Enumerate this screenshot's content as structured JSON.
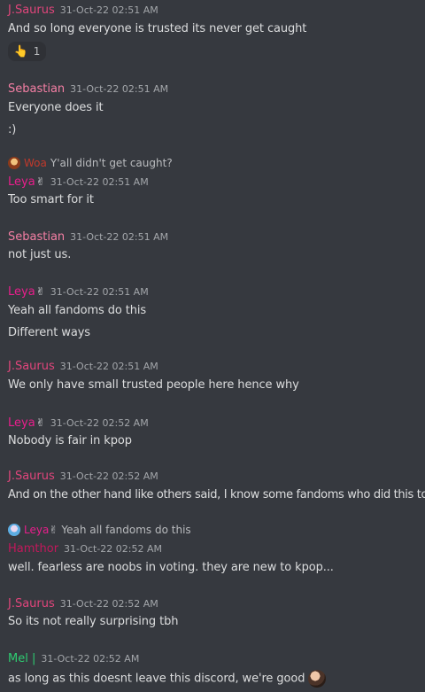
{
  "colors": {
    "jsaurus": "#e0457b",
    "sebastian": "#f47fa4",
    "leya": "#e91e8c",
    "woa": "#c0392b",
    "hamthor": "#c2185b",
    "mel": "#2ecc71",
    "timestamp": "#a3a6aa",
    "background": "#36393f"
  },
  "messages": [
    {
      "author": "J.Saurus",
      "time": "31-Oct-22 02:51 AM",
      "lines": [
        "And so long everyone is trusted its never get caught"
      ],
      "reaction": {
        "icon": "pointing-up-hand-icon",
        "emoji": "👆",
        "count": "1"
      }
    },
    {
      "author": "Sebastian",
      "time": "31-Oct-22 02:51 AM",
      "lines": [
        "Everyone does it",
        ":)"
      ]
    },
    {
      "reply": {
        "author": "Woa",
        "text": "Y'all didn't get caught?"
      },
      "author": "Leya",
      "author_badge": "✌",
      "time": "31-Oct-22 02:51 AM",
      "lines": [
        "Too smart for it"
      ]
    },
    {
      "author": "Sebastian",
      "time": "31-Oct-22 02:51 AM",
      "lines": [
        "not just us."
      ]
    },
    {
      "author": "Leya",
      "author_badge": "✌",
      "time": "31-Oct-22 02:51 AM",
      "lines": [
        "Yeah all fandoms do this",
        "Different ways"
      ]
    },
    {
      "author": "J.Saurus",
      "time": "31-Oct-22 02:51 AM",
      "lines": [
        "We only have small trusted people here hence why"
      ]
    },
    {
      "author": "Leya",
      "author_badge": "✌",
      "time": "31-Oct-22 02:52 AM",
      "lines": [
        "Nobody is fair in kpop"
      ]
    },
    {
      "author": "J.Saurus",
      "time": "31-Oct-22 02:52 AM",
      "lines": [
        "And on the other hand like others said, I know some fandoms who did this too"
      ]
    },
    {
      "reply": {
        "author": "Leya",
        "author_badge": "✌",
        "text": "Yeah all fandoms do this"
      },
      "author": "Hamthor",
      "time": "31-Oct-22 02:52 AM",
      "lines": [
        "well. fearless are noobs in voting. they are new to kpop..."
      ]
    },
    {
      "author": "J.Saurus",
      "time": "31-Oct-22 02:52 AM",
      "lines": [
        "So its not really surprising tbh"
      ]
    },
    {
      "author": "Mel |",
      "time": "31-Oct-22 02:52 AM",
      "lines": [
        "as long as this doesnt leave this discord, we're good"
      ]
    }
  ]
}
